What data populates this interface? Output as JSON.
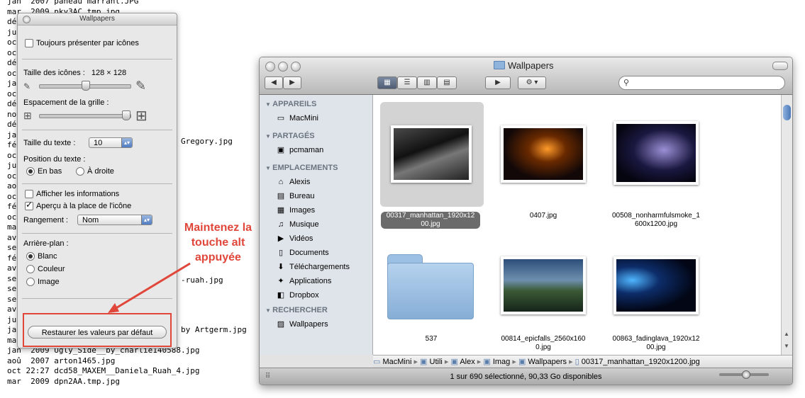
{
  "terminal": {
    "lines": [
      "jan  2007 paneau marrant.JPG",
      "mar  2009 pky3AC.tmp.jpg",
      "déc",
      "jul",
      "oct",
      "oct",
      "déc",
      "oct",
      "jan",
      "oct",
      "déc",
      "nov",
      "déc",
      "jan",
      "fév",
      "oct",
      "jul",
      "oct",
      "aoû",
      "oct",
      "fév",
      "oct",
      "mar",
      "avr",
      "sep",
      "fév",
      "avr",
      "sep",
      "sep",
      "sep",
      "avr",
      "jul",
      "jan  2009 Three Kingdoms   Xiao Qiao by Artgerm.jpg",
      "mar  2009 Tuz.svg",
      "jan  2009 Ugly_Side__by_charlie140588.jpg",
      "aoû  2007 arton1465.jpg",
      "oct 22:27 dcd58_MAXEM__Daniela_Ruah_4.jpg",
      "mar  2009 dpn2AA.tmp.jpg"
    ],
    "tails": [
      "Gregory.jpg",
      "-ruah.jpg"
    ]
  },
  "inspector": {
    "title": "Wallpapers",
    "always_icons": "Toujours présenter par icônes",
    "icon_size_label": "Taille des icônes :",
    "icon_size_value": "128 × 128",
    "grid_spacing_label": "Espacement de la grille :",
    "text_size_label": "Taille du texte :",
    "text_size_value": "10",
    "text_position_label": "Position du texte :",
    "text_bottom": "En bas",
    "text_right": "À droite",
    "show_info": "Afficher les informations",
    "preview_icon": "Aperçu à la place de l'icône",
    "arrange_label": "Rangement :",
    "arrange_value": "Nom",
    "background_label": "Arrière-plan :",
    "bg_white": "Blanc",
    "bg_color": "Couleur",
    "bg_image": "Image",
    "restore_button": "Restaurer les valeurs par défaut"
  },
  "annotation": {
    "line1": "Maintenez la",
    "line2": "touche alt",
    "line3": "appuyée"
  },
  "finder": {
    "title": "Wallpapers",
    "sidebar": {
      "devices_header": "APPAREILS",
      "devices": [
        "MacMini"
      ],
      "shared_header": "PARTAGÉS",
      "shared": [
        "pcmaman"
      ],
      "places_header": "EMPLACEMENTS",
      "places": [
        "Alexis",
        "Bureau",
        "Images",
        "Musique",
        "Vidéos",
        "Documents",
        "Téléchargements",
        "Applications",
        "Dropbox"
      ],
      "search_header": "RECHERCHER",
      "search": [
        "Wallpapers"
      ]
    },
    "files": [
      {
        "name1": "00317_manhattan_1920x12",
        "name2": "00.jpg"
      },
      {
        "name1": "0407.jpg",
        "name2": ""
      },
      {
        "name1": "00508_nonharmfulsmoke_1",
        "name2": "600x1200.jpg"
      },
      {
        "name1": "537",
        "name2": ""
      },
      {
        "name1": "00814_epicfalls_2560x160",
        "name2": "0.jpg"
      },
      {
        "name1": "00863_fadinglava_1920x12",
        "name2": "00.jpg"
      }
    ],
    "path": [
      "MacMini",
      "Utili",
      "Alex",
      "Imag",
      "Wallpapers",
      "00317_manhattan_1920x1200.jpg"
    ],
    "status": "1 sur 690 sélectionné, 90,33 Go disponibles",
    "colors": {
      "accent": "#e0473a",
      "selection": "#6b6b6b"
    }
  }
}
